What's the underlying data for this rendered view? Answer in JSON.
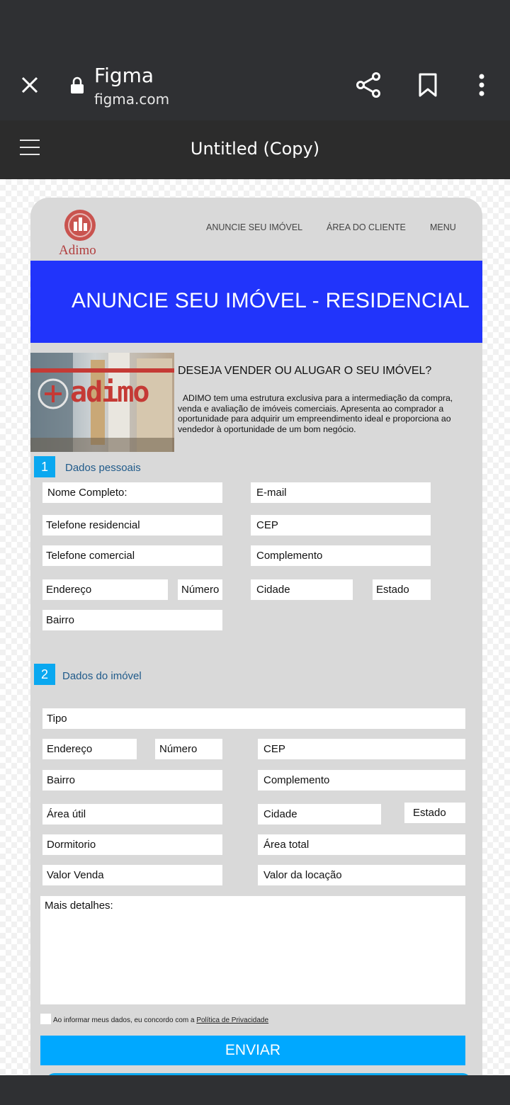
{
  "browser": {
    "site_title": "Figma",
    "site_url": "figma.com"
  },
  "figma": {
    "file_title": "Untitled (Copy)"
  },
  "site": {
    "logo_text": "Adimo",
    "nav": [
      "ANUNCIE SEU IMÓVEL",
      "ÁREA DO CLIENTE",
      "MENU"
    ],
    "banner_title": "ANUNCIE SEU IMÓVEL - RESIDENCIAL",
    "photo_text": "adimo",
    "intro_heading": "DESEJA VENDER OU ALUGAR O SEU IMÓVEL?",
    "intro_body": "ADIMO tem uma estrutura exclusiva para a intermediação da compra, venda e avaliação de imóveis comerciais. Apresenta ao comprador a oportunidade para adquirir um empreendimento ideal e proporciona ao vendedor à oportunidade de um bom negócio."
  },
  "section1": {
    "number": "1",
    "label": "Dados pessoais",
    "fields": {
      "nome": "Nome Completo:",
      "email": "E-mail",
      "tel_res": "Telefone residencial",
      "cep": "CEP",
      "tel_com": "Telefone comercial",
      "complemento": "Complemento",
      "endereco": "Endereço",
      "numero": "Número",
      "cidade": "Cidade",
      "estado": "Estado",
      "bairro": "Bairro"
    }
  },
  "section2": {
    "number": "2",
    "label": "Dados do imóvel",
    "fields": {
      "tipo": "Tipo",
      "endereco": "Endereço",
      "numero": "Número",
      "cep": "CEP",
      "bairro": "Bairro",
      "complemento": "Complemento",
      "area_util": "Área útil",
      "cidade": "Cidade",
      "estado": "Estado",
      "dormitorio": "Dormitorio",
      "area_total": "Área total",
      "valor_venda": "Valor Venda",
      "valor_locacao": "Valor da locação",
      "detalhes": "Mais detalhes:"
    }
  },
  "consent": {
    "text": "Ao informar meus dados, eu concordo com a ",
    "link": "Política de Privacidade"
  },
  "submit_label": "ENVIAR"
}
